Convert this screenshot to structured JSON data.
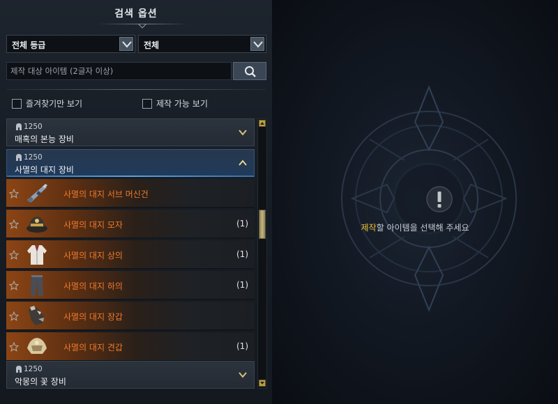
{
  "header": {
    "title": "검색 옵션"
  },
  "filters": {
    "grade_select": "전체 등급",
    "category_select": "전체",
    "search_placeholder": "제작 대상 아이템 (2글자 이상)",
    "favorites_only": "즐겨찾기만 보기",
    "craftable_only": "제작 가능 보기"
  },
  "groups": [
    {
      "level": "1250",
      "name": "매혹의 본능 장비",
      "expanded": false
    },
    {
      "level": "1250",
      "name": "사멸의 대지 장비",
      "expanded": true
    },
    {
      "level": "1250",
      "name": "악몽의 꽃 장비",
      "expanded": false
    }
  ],
  "items": [
    {
      "name": "사멸의 대지 서브 머신건",
      "count": "",
      "icon": "submachine-gun-icon"
    },
    {
      "name": "사멸의 대지 모자",
      "count": "(1)",
      "icon": "hat-icon"
    },
    {
      "name": "사멸의 대지 상의",
      "count": "(1)",
      "icon": "coat-icon"
    },
    {
      "name": "사멸의 대지 하의",
      "count": "(1)",
      "icon": "pants-icon"
    },
    {
      "name": "사멸의 대지 장갑",
      "count": "",
      "icon": "gloves-icon"
    },
    {
      "name": "사멸의 대지 견갑",
      "count": "(1)",
      "icon": "shoulder-armor-icon"
    }
  ],
  "detail": {
    "message_highlight": "제작",
    "message_rest": "할 아이템을 선택해 주세요"
  },
  "colors": {
    "item_name": "#ef7a2c",
    "highlight": "#f0c23a",
    "selected_group": "#1f3a5c"
  }
}
